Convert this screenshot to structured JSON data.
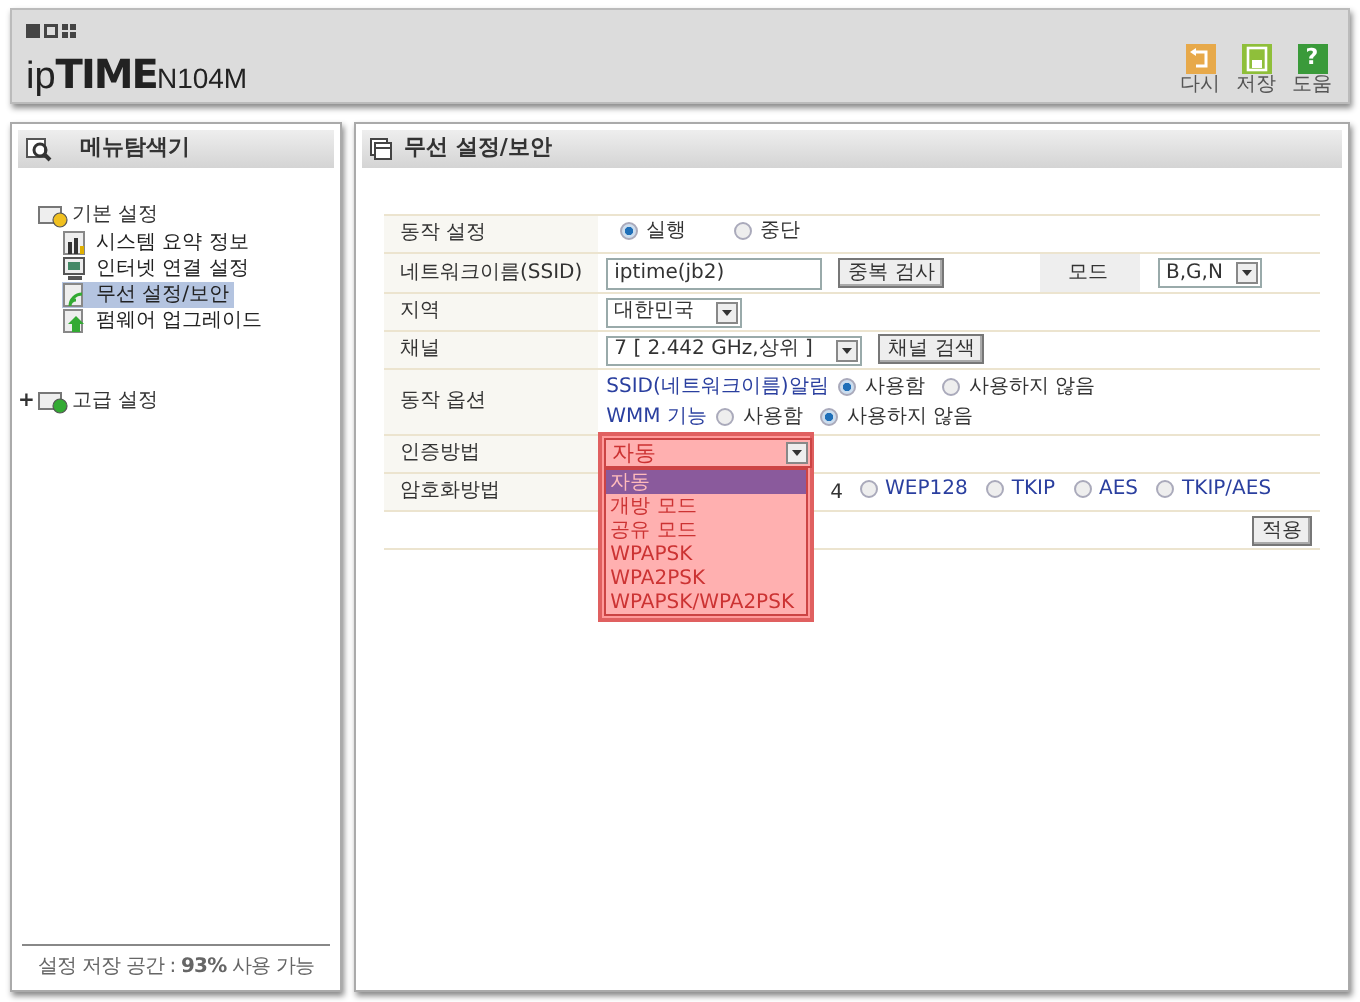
{
  "header": {
    "logo": {
      "prefix": "ip",
      "brand": "TIME",
      "model": "N104M"
    },
    "buttons": [
      {
        "kind": "undo",
        "label": "다시"
      },
      {
        "kind": "save",
        "label": "저장"
      },
      {
        "kind": "help",
        "glyph": "?",
        "label": "도움"
      }
    ]
  },
  "sidebar": {
    "title": "메뉴탐색기",
    "tree": [
      {
        "label": "기본 설정",
        "expanded": true,
        "children": [
          {
            "label": "시스템 요약 정보",
            "kind": "chart",
            "selected": false
          },
          {
            "label": "인터넷 연결 설정",
            "kind": "monitor",
            "selected": false
          },
          {
            "label": "무선 설정/보안",
            "kind": "wireless",
            "selected": true
          },
          {
            "label": "펌웨어 업그레이드",
            "kind": "upgrade",
            "selected": false
          }
        ]
      },
      {
        "label": "고급 설정",
        "expanded": false,
        "toggle": "+"
      }
    ],
    "footer": "설정 저장 공간 : **93%** 사용 가능"
  },
  "main": {
    "title": "무선 설정/보안",
    "operation": {
      "label": "동작 설정",
      "options": [
        {
          "label": "실행",
          "selected": true
        },
        {
          "label": "중단",
          "selected": false
        }
      ]
    },
    "ssid": {
      "label": "네트워크이름(SSID)",
      "value": "iptime(jb2)",
      "button": "중복 검사",
      "mode_label": "모드",
      "mode_value": "B,G,N"
    },
    "region": {
      "label": "지역",
      "value": "대한민국"
    },
    "channel": {
      "label": "채널",
      "value": "7 [ 2.442 GHz,상위 ]",
      "button": "채널 검색"
    },
    "options": {
      "label": "동작 옵션",
      "items": [
        {
          "label": "SSID(네트워크이름)알림",
          "choices": [
            {
              "label": "사용함",
              "selected": true
            },
            {
              "label": "사용하지 않음",
              "selected": false
            }
          ]
        },
        {
          "label": "WMM 기능",
          "choices": [
            {
              "label": "사용함",
              "selected": false
            },
            {
              "label": "사용하지 않음",
              "selected": true
            }
          ]
        }
      ]
    },
    "auth": {
      "label": "인증방법",
      "value": "자동",
      "open": true,
      "choices": [
        {
          "label": "자동",
          "selected": true
        },
        {
          "label": "개방 모드",
          "selected": false
        },
        {
          "label": "공유 모드",
          "selected": false
        },
        {
          "label": "WPAPSK",
          "selected": false
        },
        {
          "label": "WPA2PSK",
          "selected": false
        },
        {
          "label": "WPAPSK/WPA2PSK",
          "selected": false
        }
      ]
    },
    "encryption": {
      "label": "암호화방법",
      "fragment": "4",
      "choices": [
        {
          "label": "WEP128",
          "selected": false
        },
        {
          "label": "TKIP",
          "selected": false
        },
        {
          "label": "AES",
          "selected": false
        },
        {
          "label": "TKIP/AES",
          "selected": false
        }
      ]
    },
    "apply": "적용"
  }
}
